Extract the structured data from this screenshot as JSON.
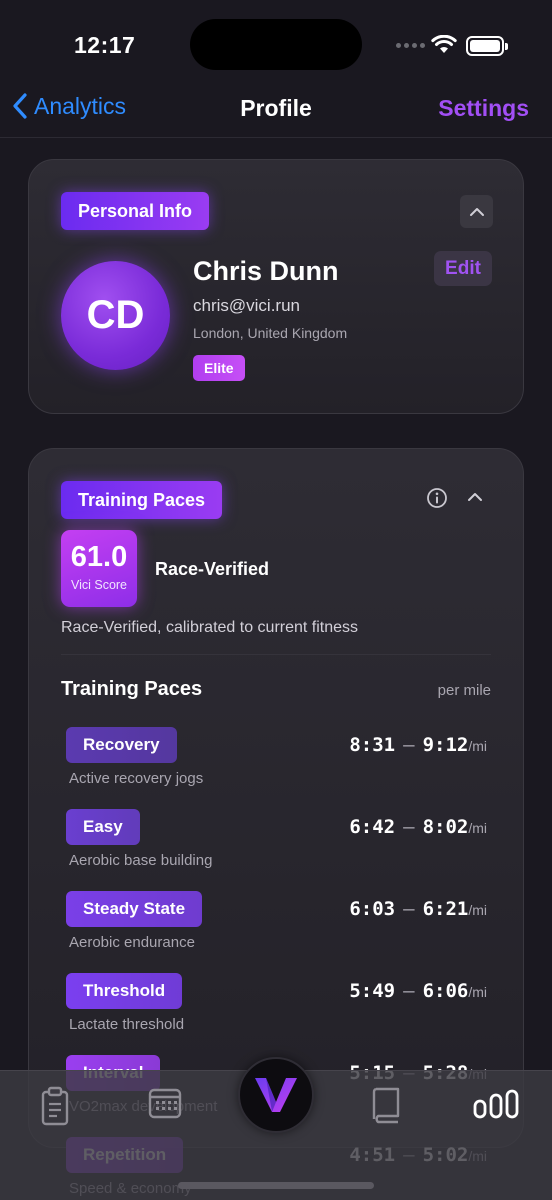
{
  "status": {
    "time": "12:17"
  },
  "nav": {
    "back_label": "Analytics",
    "title": "Profile",
    "settings_label": "Settings"
  },
  "profile": {
    "header": "Personal Info",
    "initials": "CD",
    "name": "Chris Dunn",
    "email": "chris@vici.run",
    "location": "London, United Kingdom",
    "badge": "Elite",
    "edit_label": "Edit"
  },
  "paces": {
    "header": "Training Paces",
    "score": "61.0",
    "score_label": "Vici Score",
    "verified": "Race-Verified",
    "calibration": "Race-Verified, calibrated to current fitness",
    "section_title": "Training Paces",
    "unit_label": "per mile",
    "zones": [
      {
        "name": "Recovery",
        "desc": "Active recovery jogs",
        "min": "8:31",
        "max": "9:12",
        "unit": "/mi",
        "color": "#5b3ab0"
      },
      {
        "name": "Easy",
        "desc": "Aerobic base building",
        "min": "6:42",
        "max": "8:02",
        "unit": "/mi",
        "color": "#6a3fd0"
      },
      {
        "name": "Steady State",
        "desc": "Aerobic endurance",
        "min": "6:03",
        "max": "6:21",
        "unit": "/mi",
        "color": "#7a3fe8"
      },
      {
        "name": "Threshold",
        "desc": "Lactate threshold",
        "min": "5:49",
        "max": "6:06",
        "unit": "/mi",
        "color": "#7b3ff0"
      },
      {
        "name": "Interval",
        "desc": "VO2max development",
        "min": "5:15",
        "max": "5:28",
        "unit": "/mi",
        "color": "#9a3ef0"
      },
      {
        "name": "Repetition",
        "desc": "Speed & economy",
        "min": "4:51",
        "max": "5:02",
        "unit": "/mi",
        "color": "#8a3ad8"
      }
    ]
  },
  "tabs": [
    "clipboard-icon",
    "calendar-icon",
    "vici-logo-icon",
    "book-icon",
    "stats-icon"
  ]
}
